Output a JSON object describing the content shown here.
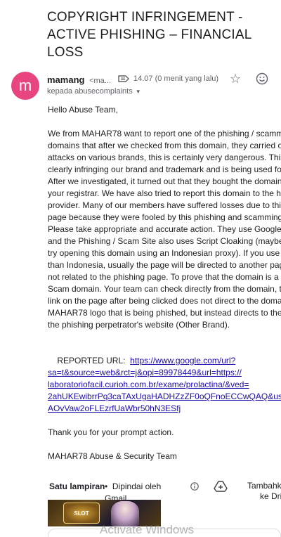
{
  "email": {
    "subject": "COPYRIGHT INFRINGEMENT - ACTIVE PHISHING – FINANCIAL LOSS",
    "sender": {
      "avatar_letter": "m",
      "avatar_color": "#e8457e",
      "name": "mamang",
      "email_truncated": "<ma..."
    },
    "timestamp": "14.07 (0 menit yang lalu)",
    "recipient": "kepada abusecomplaints",
    "greeting": "Hello Abuse Team,",
    "body_lines": [
      "We from MAHAR78 want to report one of the phishing / scamming",
      "domains that after we checked from this domain, they carried out",
      "attacks on various brands, this is certainly very dangerous. This",
      "clearly infringing our brand and trademark and is being used for p",
      "After we investigated, it turned out that they bought the domain t",
      "your registrar. We have also tried to report this domain to the hos",
      "provider. Many of our members have suffered losses due to this",
      "page because they were fooled by this phishing and scamming p",
      "Please take appropriate and accurate action. They use Google A",
      "and the Phishing / Scam Site also uses Script Cloaking (maybe y",
      "try opening this domain using an Indonesian proxy). If you use a",
      "than Indonesia, usually the page will be directed to another page",
      "not related to the phishing page. To prove that the domain is a Pl",
      "Scam domain. Your team can check directly from the domain, the",
      "link on the page after being clicked does not direct to the domain",
      "MAHAR78 logo that is being phished, but instead directs to the b",
      "the phishing perpetrator's website (Other Brand)."
    ],
    "reported_label": "REPORTED URL:",
    "reported_url_lines": [
      "https://www.google.com/url?",
      "sa=t&source=web&rct=j&opi=89978449&url=https://",
      "laboratoriofacil.curioh.com.br/exame/prolactina/&ved=",
      "2ahUKEwibrrPq3caTAxUgaHADHZzZF0oQFnoECCwQAQ&usg",
      "AOvVaw2oFLEzrfUaWbr50hN3ESfj"
    ],
    "thanks": "Thank you for your prompt action.",
    "signature": "MAHAR78 Abuse & Security Team"
  },
  "attachments": {
    "count_label": "Satu lampiran",
    "bullet": "•",
    "scan_label": "Dipindai oleh Gmail",
    "add_drive_label": "Tambahkan ke Drive",
    "thumbnail_text": "SLOT GACOR"
  },
  "overlay": {
    "watermark": "Activate Windows"
  },
  "icons": {
    "label": "label-icon",
    "star": "star-icon",
    "emoji": "emoji-react-icon",
    "info": "info-icon",
    "drive": "drive-add-icon",
    "caret": "chevron-down-icon"
  }
}
